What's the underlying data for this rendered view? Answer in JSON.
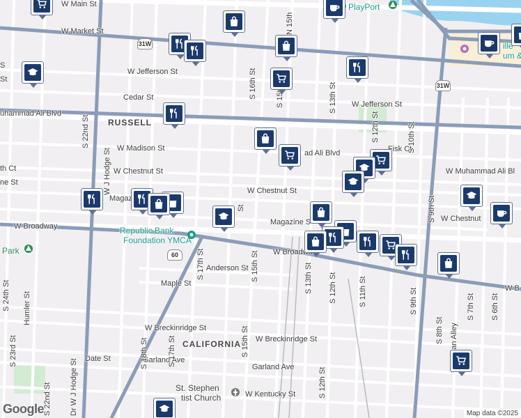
{
  "map": {
    "streets": {
      "w_main": "W Main St",
      "w_market": "W Market St",
      "w_jefferson_1": "W Jefferson St",
      "w_jefferson_2": "W Jefferson St",
      "cedar": "Cedar St",
      "muhammad_ali_w": "uhammad Ali Blvd",
      "muhammad_ali_mid": "ad Ali Blvd",
      "muhammad_ali_e": "W Muhammad Ali Bl",
      "w_madison": "W Madison St",
      "w_chestnut_1": "W Chestnut St",
      "w_chestnut_2": "W Chestnut St",
      "w_chestnut_3": "W Chestnut",
      "chestnut_ct": "th Ct",
      "magazine_w": "Magaz",
      "magazine_e": "Magazine S",
      "w_broadway_w": "W Broadway",
      "w_broadway_mid": "W Broadway",
      "w_broadway_e": "W B",
      "anderson": "Anderson St",
      "maple": "Maple St",
      "w_breckinridge_w": "W Breckinridge St",
      "w_breckinridge_e": "W Breckinridge St",
      "garland_w": "Garland Ave",
      "garland_e": "Garland Ave",
      "date": "Date St",
      "w_kentucky": "W Kentucky St",
      "fisk": "Fisk Ct",
      "ne_st": "ne St",
      "s_22nd": "S 22nd St",
      "dr_wj_hodge_n": "W J Hodge St",
      "dr_wj_hodge_s": "Dr W J Hodge St",
      "s_16th": "S 16th St",
      "s_15th_n": "S 15th St",
      "s_15th_s": "S 15th St",
      "s_15th_mid": "S 15th St",
      "n_15th": "N 15th",
      "s_13th_n": "S 13th St",
      "s_13th_s": "S 13th St",
      "s_12th_n": "S 12th St",
      "s_12th_s": "S 12th St",
      "s_12th_far": "S 12th St",
      "s_11th": "S 11th St",
      "s_10th": "S 10th St",
      "s_9th_n": "S 9th St",
      "s_9th_s": "S 9th St",
      "s_8th": "S 8th St",
      "s_7th": "S 7th St",
      "s_6th": "S 6th St",
      "s_17th_n": "S 17th St",
      "s_17th_s": "S 17th St",
      "s_18th": "S 18th St",
      "s_24th": "S 24th St",
      "s_23rd": "S 23rd St",
      "humler": "Humler St",
      "s_st": "St",
      "s_st2": "S",
      "st_short": "St",
      "alley": "Trishman Alley",
      "s_st_b": "S"
    },
    "districts": {
      "russell": "RUSSELL",
      "california": "CALIFORNIA"
    },
    "places": {
      "ymca_1": "Republic Bank",
      "ymca_2": "Foundation YMCA",
      "church_1": "St. Stephen",
      "church_2": "tist Church",
      "playport": "PlayPort",
      "museum": "ille",
      "museum2": "um &",
      "park": "Park"
    },
    "shields": {
      "us31w_a": "31W",
      "us31w_b": "31W",
      "us60": "60"
    },
    "markers": [
      {
        "icon": "cart-icon",
        "kind": "shopping"
      },
      {
        "icon": "bag-icon",
        "kind": "shopping"
      },
      {
        "icon": "bag-icon",
        "kind": "shopping"
      },
      {
        "icon": "coffee-icon",
        "kind": "cafe"
      },
      {
        "icon": "coffee-icon",
        "kind": "cafe"
      },
      {
        "icon": "coffee-icon",
        "kind": "cafe"
      },
      {
        "icon": "restaurant-icon",
        "kind": "food"
      },
      {
        "icon": "school-icon",
        "kind": "school"
      }
    ],
    "attribution": "Map data ©2025",
    "logo": "Google",
    "colors": {
      "background": "#f1eff1",
      "highway": "#8a9cb8",
      "street": "#ffffff",
      "water": "#9ad3f0",
      "pin": "#1b3a6b",
      "park": "#c8e6c9"
    }
  }
}
